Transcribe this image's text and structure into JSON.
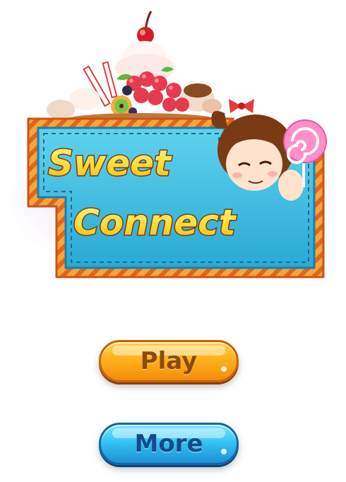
{
  "logo": {
    "line1": "Sweet",
    "line2": "Connect"
  },
  "buttons": {
    "play_label": "Play",
    "more_label": "More"
  },
  "colors": {
    "banner_fill": "#43c2e3",
    "banner_border": "#f79a2c",
    "title_fill": "#ffe44a",
    "title_stroke": "#7a3a12",
    "play_button": "#ffb21c",
    "more_button": "#33c4f4"
  }
}
